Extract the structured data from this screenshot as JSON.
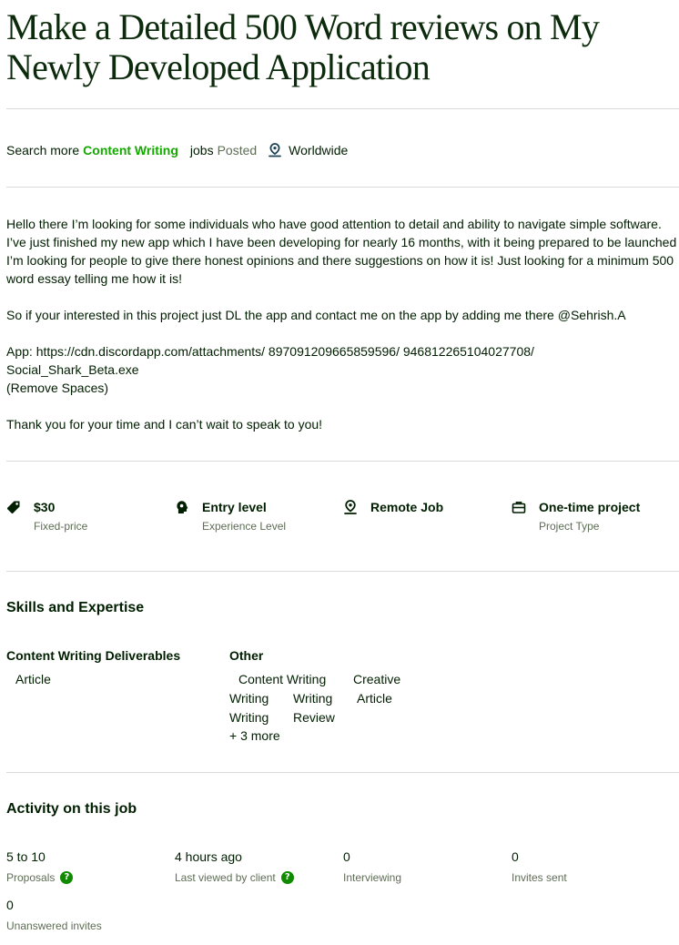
{
  "job": {
    "title": "Make a Detailed 500 Word reviews on My Newly Developed Application"
  },
  "meta": {
    "search_more": "Search more",
    "category": "Content Writing",
    "jobs": "jobs",
    "posted": "Posted",
    "location": "Worldwide",
    "location_icon": "location-pin-icon"
  },
  "description": {
    "p1": "Hello there I’m looking for some individuals who have good attention to detail and ability to navigate simple software. I’ve just finished my new app which I have been developing for nearly 16 months, with it being prepared to be launched I’m looking for people to give there honest opinions and there suggestions on how it is! Just looking for a minimum 500 word essay telling me how it is!",
    "p2": "So if your interested in this project just DL the app and contact me on the app by adding me there @Sehrish.A",
    "p3_line1": "App: https://cdn.discordapp.com/attachments/ 897091209665859596/ 946812265104027708/",
    "p3_line2": "Social_Shark_Beta.exe",
    "p3_line3": "(Remove Spaces)",
    "p4": "Thank you for your time and I can’t wait to speak to you!"
  },
  "features": [
    {
      "value": "$30",
      "label": "Fixed-price",
      "icon": "price-tag-icon"
    },
    {
      "value": "Entry level",
      "label": "Experience Level",
      "icon": "brain-head-icon"
    },
    {
      "value": "Remote Job",
      "label": "",
      "icon": "location-pin-icon"
    },
    {
      "value": "One-time project",
      "label": "Project Type",
      "icon": "briefcase-icon"
    }
  ],
  "skills": {
    "heading": "Skills and Expertise",
    "group1": {
      "title": "Content Writing Deliverables",
      "items": [
        "Article"
      ]
    },
    "group2": {
      "title": "Other",
      "items": [
        "Content Writing",
        "Creative",
        "Writing",
        "Writing",
        "Article",
        "Writing",
        "Review"
      ],
      "more": "+ 3 more"
    }
  },
  "activity": {
    "heading": "Activity on this job",
    "items": [
      {
        "value": "5 to 10",
        "label": "Proposals"
      },
      {
        "value": "4 hours ago",
        "label": "Last viewed by client"
      },
      {
        "value": "0",
        "label": "Interviewing"
      },
      {
        "value": "0",
        "label": "Invites sent"
      },
      {
        "value": "0",
        "label": "Unanswered invites"
      }
    ],
    "help_glyph": "?"
  },
  "colors": {
    "accent": "#14a800",
    "help": "#108a00",
    "muted": "#5e6d55",
    "divider": "#d9d9d9"
  }
}
